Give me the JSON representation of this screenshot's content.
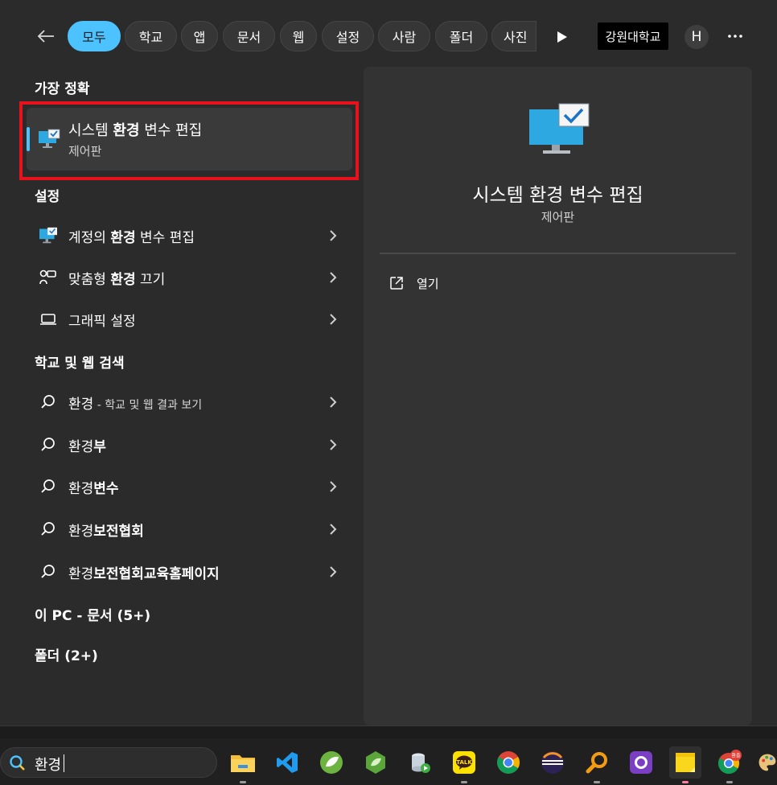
{
  "filters": {
    "chips": [
      "모두",
      "학교",
      "앱",
      "문서",
      "웹",
      "설정",
      "사람",
      "폴더",
      "사진"
    ],
    "active": "모두",
    "org_name": "강원대학교",
    "avatar_letter": "H"
  },
  "best_match": {
    "section_title": "가장 정확",
    "title_pre": "시스템 ",
    "title_bold": "환경",
    "title_post": " 변수 편집",
    "subtitle": "제어판"
  },
  "settings": {
    "section_title": "설정",
    "items": [
      {
        "pre": "계정의 ",
        "bold": "환경",
        "post": " 변수 편집",
        "icon": "monitor-check-icon"
      },
      {
        "pre": "맞춤형 ",
        "bold": "환경",
        "post": " 끄기",
        "icon": "personalization-icon"
      },
      {
        "pre": "그래픽 설정",
        "bold": "",
        "post": "",
        "icon": "laptop-icon"
      }
    ]
  },
  "web_search": {
    "section_title": "학교 및 웹 검색",
    "items": [
      {
        "pre": "환경",
        "bold": "",
        "post": "",
        "hint": " - 학교 및 웹 결과 보기"
      },
      {
        "pre": "환경",
        "bold": "부",
        "post": "",
        "hint": ""
      },
      {
        "pre": "환경",
        "bold": "변수",
        "post": "",
        "hint": ""
      },
      {
        "pre": "환경",
        "bold": "보전협회",
        "post": "",
        "hint": ""
      },
      {
        "pre": "환경",
        "bold": "보전협회교육홈페이지",
        "post": "",
        "hint": ""
      }
    ]
  },
  "pc_docs": {
    "section_title": "이 PC - 문서 (5+)"
  },
  "folders": {
    "section_title": "폴더 (2+)"
  },
  "preview": {
    "title": "시스템 환경 변수 편집",
    "subtitle": "제어판",
    "open_label": "열기"
  },
  "taskbar": {
    "search_value": "환경",
    "apps": [
      {
        "name": "file-explorer-icon",
        "running": true
      },
      {
        "name": "vscode-icon",
        "running": false
      },
      {
        "name": "spring-tool-suite-icon",
        "running": false
      },
      {
        "name": "spring-boot-icon",
        "running": false
      },
      {
        "name": "database-tool-icon",
        "running": false
      },
      {
        "name": "kakaotalk-icon",
        "label": "TALK",
        "running": true
      },
      {
        "name": "chrome-icon",
        "running": false
      },
      {
        "name": "eclipse-icon",
        "running": false
      },
      {
        "name": "search-tool-icon",
        "running": true
      },
      {
        "name": "github-desktop-icon",
        "running": false
      },
      {
        "name": "sticky-notes-icon",
        "running": true,
        "active": true
      },
      {
        "name": "chrome-profile-icon",
        "badge": "환종",
        "running": true
      },
      {
        "name": "paint-icon",
        "running": false
      }
    ]
  },
  "colors": {
    "accent": "#4cc2ff",
    "highlight_box": "#e8121c",
    "panel_bg": "#2b2b2b",
    "preview_bg": "#333333"
  }
}
